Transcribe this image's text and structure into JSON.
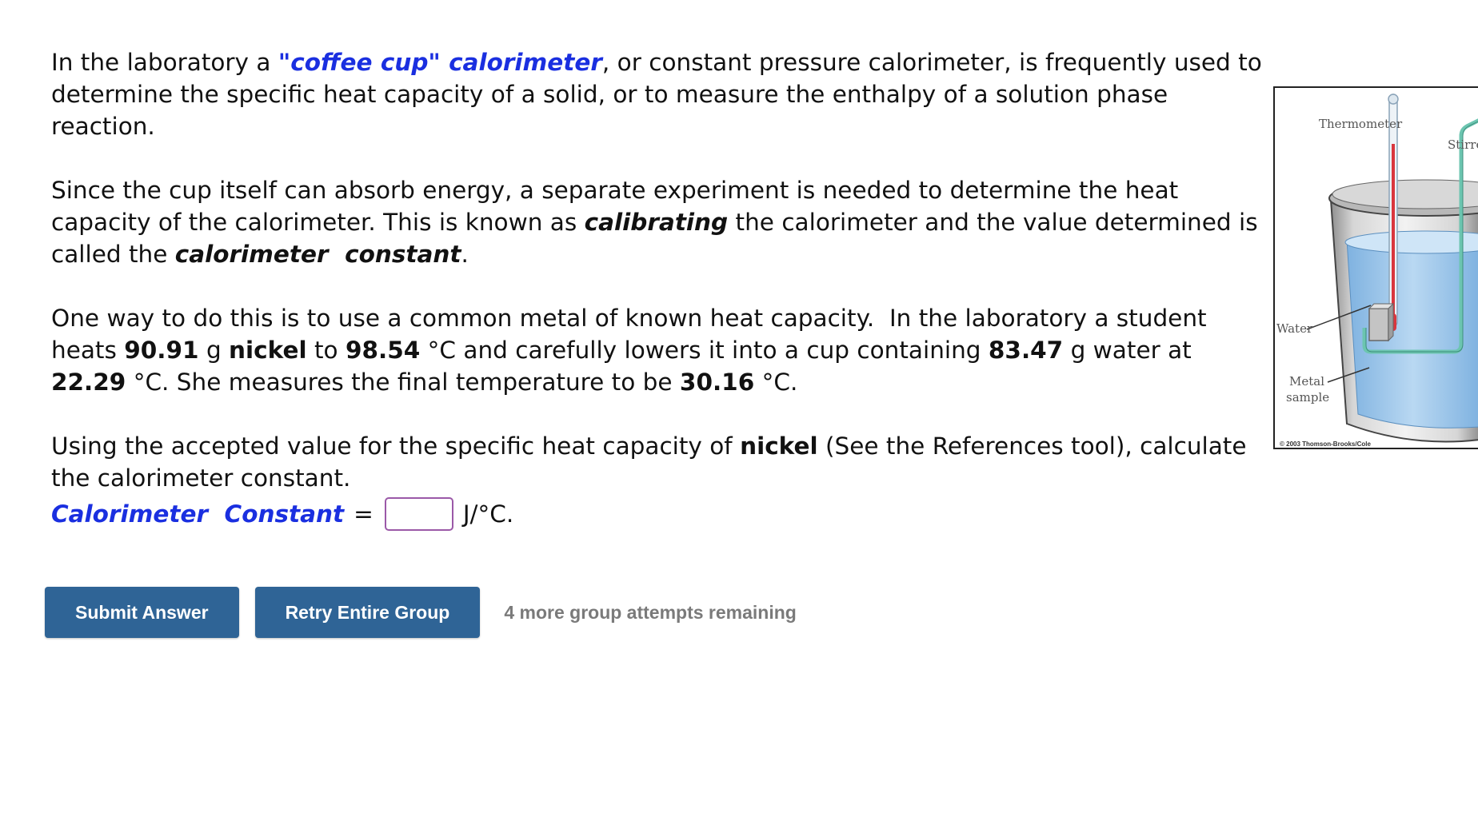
{
  "problem": {
    "p1": {
      "t1": "In the laboratory a ",
      "term": "\"coffee cup\" calorimeter",
      "t2": ", or constant pressure calorimeter, is frequently used to determine the specific heat capacity of a solid, or to measure the enthalpy of a solution phase reaction."
    },
    "p2": {
      "t1": "Since the cup itself can absorb energy, a separate experiment is needed to determine the heat capacity of the calorimeter. This is known as ",
      "term1": "calibrating",
      "t2": " the calorimeter and the value determined is called the ",
      "term2": "calorimeter  constant",
      "t3": "."
    },
    "p3": {
      "t1": "One way to do this is to use a common metal of known heat capacity.  In the laboratory a student heats ",
      "mass_metal": "90.91",
      "t2": " g ",
      "metal": "nickel",
      "t3": " to ",
      "temp_metal": "98.54",
      "t4": " °C and carefully lowers it into a cup containing ",
      "mass_water": "83.47",
      "t5": " g water at ",
      "temp_water": "22.29",
      "t6": " °C. She measures the final temperature to be ",
      "temp_final": "30.16",
      "t7": " °C."
    },
    "p4": {
      "t1": "Using the accepted value for the specific heat capacity of ",
      "metal": "nickel",
      "t2": " (See the References tool), calculate the calorimeter constant."
    },
    "answer": {
      "label": "Calorimeter  Constant",
      "equals": "=",
      "value": "",
      "unit": "J/°C."
    }
  },
  "figure": {
    "label_thermometer": "Thermometer",
    "label_stirrer": "Stirrer",
    "label_water": "Water",
    "label_metal_1": "Metal",
    "label_metal_2": "sample",
    "credit": "© 2003 Thomson-Brooks/Cole",
    "colors": {
      "water": "#9fc6ea",
      "cup": "#c8c8c8",
      "thermometer_fluid": "#d9363e",
      "stirrer": "#6cc5b0"
    }
  },
  "actions": {
    "submit_label": "Submit Answer",
    "retry_label": "Retry Entire Group",
    "attempts_text": "4 more group attempts remaining"
  },
  "colors": {
    "accent_blue_text": "#1a2fe0",
    "button_bg": "#2f6496",
    "input_border": "#9b59a8"
  }
}
